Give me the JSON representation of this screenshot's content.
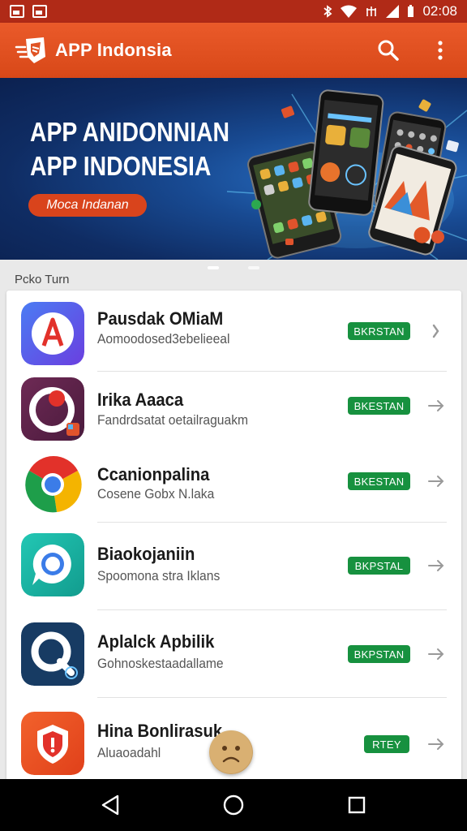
{
  "status_bar": {
    "time": "02:08"
  },
  "app_bar": {
    "title": "APP Indonsia"
  },
  "banner": {
    "headline_1": "APP ANIDONNIAN",
    "headline_2": "APP INDONESIA",
    "cta_label": "Moca Indanan"
  },
  "section": {
    "label": "Pcko Turn"
  },
  "apps": [
    {
      "name": "Pausdak OMiaM",
      "desc": "Aomoodosed3ebelieeal",
      "status": "BKRSTAN",
      "icon": "app-icon-red-a",
      "badge_color": "#17913f"
    },
    {
      "name": "Irika Aaaca",
      "desc": "Fandrdsatat oetailraguakm",
      "status": "BKESTAN",
      "icon": "app-icon-purple-ring",
      "badge_color": "#17913f"
    },
    {
      "name": "Ccanionpalina",
      "desc": "Cosene Gobx N.laka",
      "status": "BKESTAN",
      "icon": "app-icon-chrome",
      "badge_color": "#17913f"
    },
    {
      "name": "Biaokojaniin",
      "desc": "Spoomona stra Iklans",
      "status": "BKPSTAL",
      "icon": "app-icon-chat-bubble",
      "badge_color": "#17913f"
    },
    {
      "name": "Aplalck Apbilik",
      "desc": "Gohnoskestaadallame",
      "status": "BKPSTAN",
      "icon": "app-icon-q-magnifier",
      "badge_color": "#17913f"
    },
    {
      "name": "Hina Bonlirasuk",
      "desc": "Aluaoadahl",
      "status": "RTEY",
      "icon": "app-icon-shield",
      "badge_color": "#17913f"
    }
  ],
  "icons": {
    "search": "search-icon",
    "more": "more-vert-icon",
    "arrow": "chevron-right-icon",
    "nav_back": "back-triangle-icon",
    "nav_home": "home-circle-icon",
    "nav_recent": "recents-square-icon"
  },
  "colors": {
    "accent": "#e8542a",
    "status_bar": "#b02a17",
    "badge": "#17913f"
  }
}
